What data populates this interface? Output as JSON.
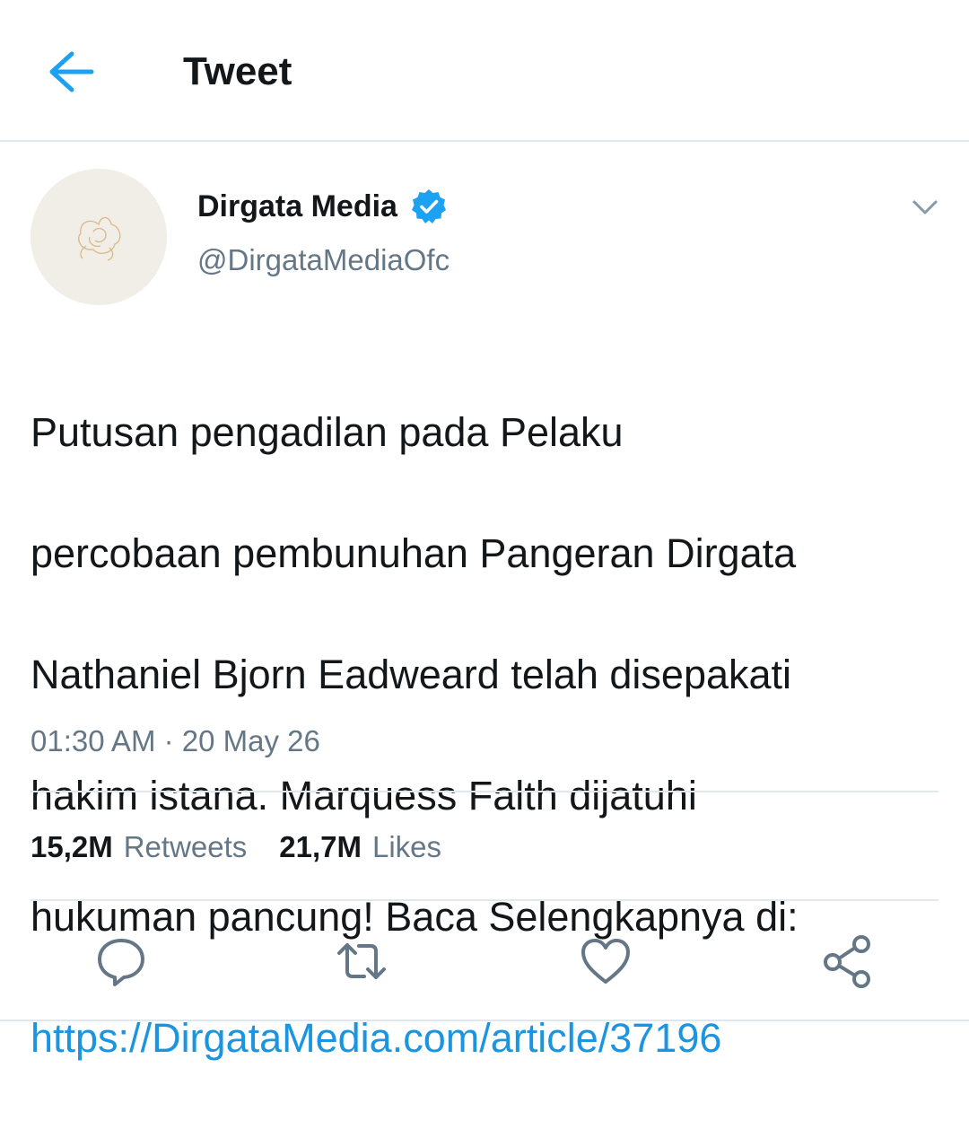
{
  "header": {
    "title": "Tweet",
    "back_icon": "arrow-left-icon"
  },
  "colors": {
    "accent": "#1da1f2",
    "link": "#1b95e0",
    "secondary_text": "#657786",
    "divider": "#e1e8ed"
  },
  "tweet": {
    "author_name": "Dirgata Media",
    "verified": true,
    "handle": "@DirgataMediaOfc",
    "text_lines": [
      "Putusan pengadilan pada Pelaku",
      "percobaan pembunuhan Pangeran Dirgata",
      "Nathaniel Bjorn Eadweard telah disepakati",
      "hakim istana. Marquess Falth dijatuhi",
      "hukuman pancung! Baca Selengkapnya di:"
    ],
    "link": "https://DirgataMedia.com/article/37196",
    "time": "01:30 AM",
    "separator": " · ",
    "date": "20 May 26"
  },
  "stats": {
    "retweets_count": "15,2M",
    "retweets_label": "Retweets",
    "likes_count": "21,7M",
    "likes_label": "Likes"
  },
  "actions": [
    "reply-icon",
    "retweet-icon",
    "like-icon",
    "share-icon"
  ]
}
